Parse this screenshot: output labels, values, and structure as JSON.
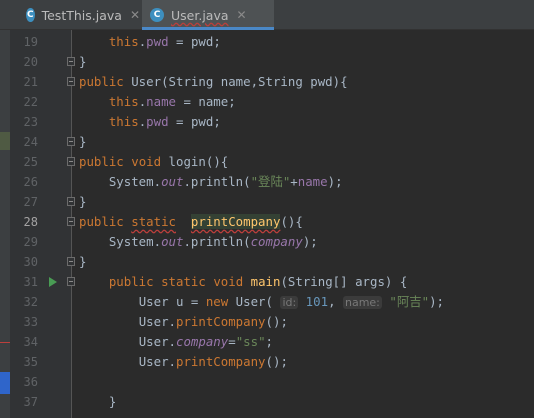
{
  "tabs": [
    {
      "label": "TestThis.java",
      "icon": "C",
      "active": false
    },
    {
      "label": "User.java",
      "icon": "C",
      "active": true
    }
  ],
  "lines": [
    {
      "n": "19"
    },
    {
      "n": "20"
    },
    {
      "n": "21"
    },
    {
      "n": "22"
    },
    {
      "n": "23"
    },
    {
      "n": "24"
    },
    {
      "n": "25"
    },
    {
      "n": "26"
    },
    {
      "n": "27"
    },
    {
      "n": "28"
    },
    {
      "n": "29"
    },
    {
      "n": "30"
    },
    {
      "n": "31"
    },
    {
      "n": "32"
    },
    {
      "n": "33"
    },
    {
      "n": "34"
    },
    {
      "n": "35"
    },
    {
      "n": "36"
    },
    {
      "n": "37"
    }
  ],
  "tokens": {
    "this": "this",
    "pwd": "pwd",
    "name": "name",
    "public": "public",
    "static": "static",
    "void": "void",
    "new": "new",
    "user_ctor_sig": " User(String name,String pwd){",
    "login": "login",
    "parens_brace": "(){",
    "system": "System.",
    "out": "out",
    "println": ".println(",
    "str_login": "\"登陆\"",
    "plus_name_close": "+",
    "print_company": "printCompany",
    "company": "company",
    "main": "main",
    "main_sig": "(String[] args) {",
    "user_u": "User u = ",
    "user_paren": " User(",
    "hint_id": "id:",
    "num_101": "101",
    "hint_name": "name:",
    "str_aji": "\"阿吉\"",
    "str_ss": "\"ss\"",
    "user_dot": "User.",
    "close_call": "();"
  },
  "colors": {
    "keyword": "#cc7832",
    "field": "#9876aa",
    "method": "#ffc66d",
    "string": "#6a8759",
    "number": "#6897bb",
    "text": "#a9b7c6",
    "background": "#2b2b2b"
  }
}
